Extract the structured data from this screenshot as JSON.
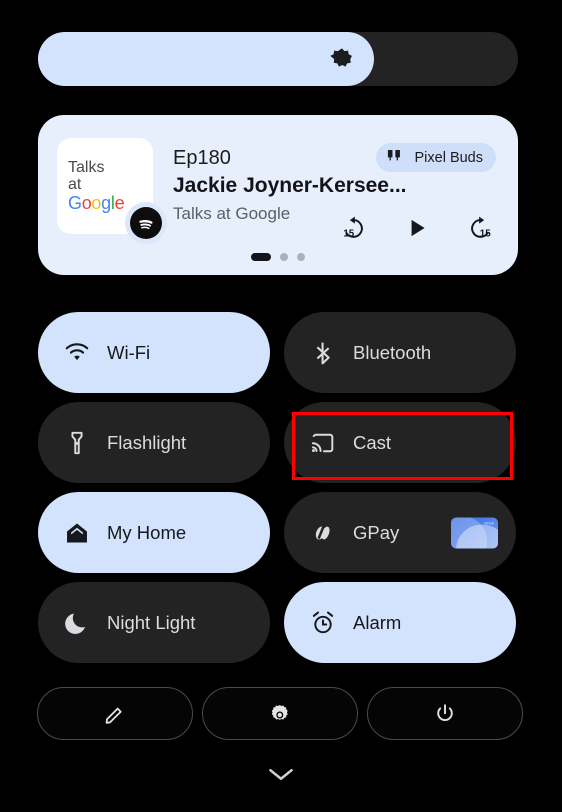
{
  "brightness": {
    "name": "brightness-slider",
    "icon": "brightness-icon",
    "level_percent": 70
  },
  "media_player": {
    "album_art": {
      "line1": "Talks",
      "line2": "at",
      "brand": "Google",
      "brand_letters": [
        "G",
        "o",
        "o",
        "g",
        "l",
        "e"
      ]
    },
    "app_badge": "spotify-icon",
    "episode": "Ep180",
    "title": "Jackie Joyner-Kersee...",
    "subtitle": "Talks at Google",
    "output_device": {
      "label": "Pixel Buds",
      "icon": "earbuds-icon"
    },
    "controls": [
      {
        "name": "rewind-15-button",
        "label": "15"
      },
      {
        "name": "play-button",
        "label": ""
      },
      {
        "name": "forward-15-button",
        "label": "15"
      }
    ],
    "page_indicator": {
      "total": 3,
      "active_index": 0
    }
  },
  "tiles": [
    [
      {
        "name": "tile-wifi",
        "label": "Wi-Fi",
        "icon": "wifi-icon",
        "state": "on"
      },
      {
        "name": "tile-bluetooth",
        "label": "Bluetooth",
        "icon": "bluetooth-icon",
        "state": "off"
      }
    ],
    [
      {
        "name": "tile-flashlight",
        "label": "Flashlight",
        "icon": "flashlight-icon",
        "state": "off"
      },
      {
        "name": "tile-cast",
        "label": "Cast",
        "icon": "cast-icon",
        "state": "off",
        "highlighted": true
      }
    ],
    [
      {
        "name": "tile-my-home",
        "label": "My Home",
        "icon": "home-icon",
        "state": "on"
      },
      {
        "name": "tile-gpay",
        "label": "GPay",
        "icon": "gpay-icon",
        "state": "off",
        "card_text": "VISA"
      }
    ],
    [
      {
        "name": "tile-night-light",
        "label": "Night Light",
        "icon": "moon-icon",
        "state": "off"
      },
      {
        "name": "tile-alarm",
        "label": "Alarm",
        "icon": "alarm-icon",
        "state": "on"
      }
    ]
  ],
  "footer_buttons": [
    {
      "name": "edit-button",
      "icon": "pencil-icon"
    },
    {
      "name": "settings-button",
      "icon": "gear-icon"
    },
    {
      "name": "power-button",
      "icon": "power-icon"
    }
  ],
  "collapse_handle": {
    "name": "collapse-chevron",
    "icon": "chevron-down-icon"
  },
  "colors": {
    "background": "#000000",
    "tile_off": "#232323",
    "tile_on": "#d3e3fd",
    "media_card": "#e8effc",
    "chip": "#cfdff9",
    "highlight": "#ff0000",
    "text_on_dark": "#dadce0",
    "text_on_light": "#16181c"
  }
}
